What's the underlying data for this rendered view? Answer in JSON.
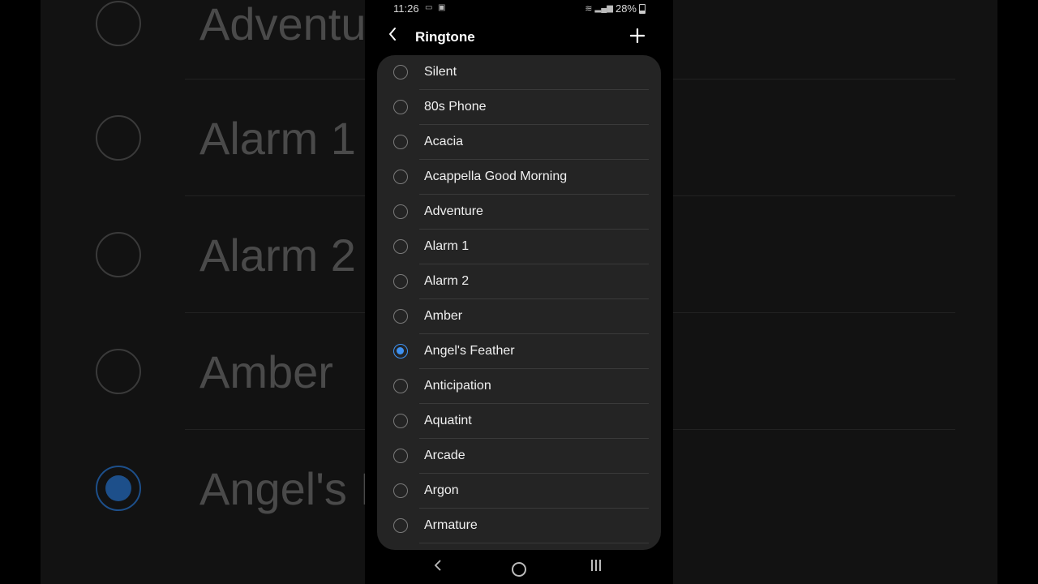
{
  "status_bar": {
    "time": "11:26",
    "battery": "28%"
  },
  "header": {
    "title": "Ringtone"
  },
  "ringtones": [
    {
      "label": "Silent",
      "selected": false
    },
    {
      "label": "80s Phone",
      "selected": false
    },
    {
      "label": "Acacia",
      "selected": false
    },
    {
      "label": "Acappella Good Morning",
      "selected": false
    },
    {
      "label": "Adventure",
      "selected": false
    },
    {
      "label": "Alarm 1",
      "selected": false
    },
    {
      "label": "Alarm 2",
      "selected": false
    },
    {
      "label": "Amber",
      "selected": false
    },
    {
      "label": "Angel's Feather",
      "selected": true
    },
    {
      "label": "Anticipation",
      "selected": false
    },
    {
      "label": "Aquatint",
      "selected": false
    },
    {
      "label": "Arcade",
      "selected": false
    },
    {
      "label": "Argon",
      "selected": false
    },
    {
      "label": "Armature",
      "selected": false
    }
  ],
  "background_zoom": {
    "labels": [
      "Adventu",
      "Alarm 1",
      "Alarm 2",
      "Amber",
      "Angel's I"
    ]
  },
  "colors": {
    "accent": "#3e91f0",
    "card": "#242424",
    "background": "#000000"
  }
}
